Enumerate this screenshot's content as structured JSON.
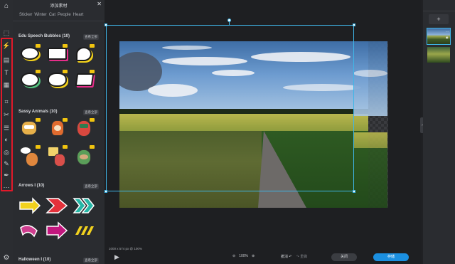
{
  "panel": {
    "title": "添加素材",
    "close": "✕",
    "tabs": [
      "Sticker",
      "Winter",
      "Cat",
      "People",
      "Heart"
    ],
    "sections": [
      {
        "title": "Edu Speech Bubbles (10)",
        "view_all": "查看全部"
      },
      {
        "title": "Sassy Animals (10)",
        "view_all": "查看全部"
      },
      {
        "title": "Arrows I (10)",
        "view_all": "查看全部"
      },
      {
        "title": "Halloween I (10)",
        "view_all": "查看全部"
      }
    ]
  },
  "rail": {
    "icons": [
      "home-icon",
      "select-icon",
      "magic-icon",
      "layout-icon",
      "text-icon",
      "texture-icon",
      "crop-icon",
      "cut-icon",
      "adjust-icon",
      "contrast-icon",
      "spiral-icon",
      "brush-icon",
      "pen-icon",
      "more-icon",
      "settings-icon"
    ]
  },
  "canvas": {
    "status": "1000 x 574 px @ 100%"
  },
  "bottom": {
    "zoom_out": "⊖",
    "zoom": "100%",
    "zoom_in": "⊕",
    "undo": "撤消",
    "redo": "重做",
    "close_button": "关闭",
    "save_button": "存储"
  },
  "colors": {
    "accent": "#1b8fe0",
    "selection": "#3fb6e8",
    "highlight": "#e2192a"
  }
}
